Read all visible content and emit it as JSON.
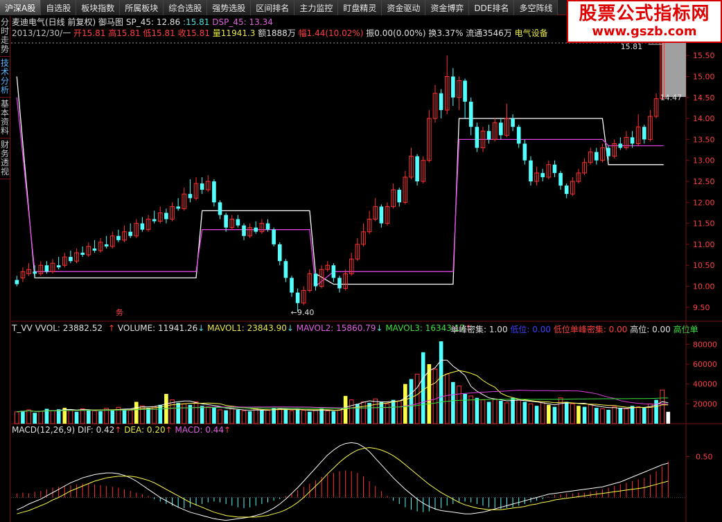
{
  "toolbar": {
    "items": [
      {
        "label": "沪深A股",
        "active": true
      },
      {
        "label": "自选股"
      },
      {
        "label": "板块指数"
      },
      {
        "label": "所属板块"
      },
      {
        "label": "综合选股"
      },
      {
        "label": "强势选股"
      },
      {
        "label": "区间排名"
      },
      {
        "label": "主力监控"
      },
      {
        "label": "盯盘精灵"
      },
      {
        "label": "资金驱动"
      },
      {
        "label": "资金博弈"
      },
      {
        "label": "DDE排名"
      },
      {
        "label": "多空阵线"
      }
    ]
  },
  "watermark": {
    "title": "股票公式指标网",
    "url": "www.gszb.com"
  },
  "left_tabs": [
    {
      "label": "分时走势"
    },
    {
      "label": "技术分析",
      "active": true
    },
    {
      "label": "基本资料"
    },
    {
      "label": "财务透视"
    }
  ],
  "header": {
    "stock_name": "麦迪电气(日线 前复权)",
    "indicator": "御马图",
    "sp_label": "SP_45: 12.86",
    "sp_value": "15.81",
    "dsp_label": "DSP_45: 13.34"
  },
  "quote": {
    "date": "2013/12/30/一",
    "open": "开15.81",
    "high": "高15.81",
    "low": "低15.81",
    "close": "收15.81",
    "volume": "量11941.3",
    "amount": "额1888万",
    "change": "幅1.44(10.02%)",
    "amplitude": "振0.00(0.00%)",
    "turnover": "换3.37%",
    "float_cap": "流通3546万",
    "sector": "电气设备"
  },
  "volume_legend": {
    "tvv": "T_VV VVOL: 23882.52",
    "volume": "VOLUME: 11941.26",
    "mavol1": "MAVOL1: 23843.90",
    "mavol2": "MAVOL2: 15860.79",
    "mavol3": "MAVOL3: 16343.17",
    "single_peak": "单峰密集: 1.00",
    "low_pos": "低位: 0.00",
    "low_peak": "低位单峰密集: 0.00",
    "high_pos": "高位: 0.00",
    "high_peak": "高位单"
  },
  "macd_legend": {
    "title": "MACD(12,26,9)",
    "dif": "DIF: 0.42",
    "dea": "DEA: 0.20",
    "macd": "MACD: 0.44"
  },
  "price_axis": {
    "labels": [
      "15.50",
      "15.00",
      "14.50",
      "14.00",
      "13.50",
      "13.00",
      "12.50",
      "12.00",
      "11.50",
      "11.00",
      "10.50",
      "10.00",
      "9.50"
    ]
  },
  "volume_axis": {
    "labels": [
      "80000",
      "60000",
      "40000",
      "20000"
    ]
  },
  "macd_axis": {
    "labels": [
      "0.50"
    ]
  },
  "annotations": {
    "high_marker": "15.81",
    "current_marker": "14.47",
    "low_marker": "9.40",
    "event_marker": "务"
  },
  "chart_data": {
    "type": "candlestick",
    "price_range": [
      9.2,
      15.8
    ],
    "candles": [
      [
        10.15,
        10.05,
        10.25,
        10.0
      ],
      [
        10.2,
        10.35,
        10.45,
        10.1
      ],
      [
        10.3,
        10.4,
        10.55,
        10.25
      ],
      [
        10.35,
        10.3,
        10.5,
        10.2
      ],
      [
        10.3,
        10.5,
        10.6,
        10.25
      ],
      [
        10.5,
        10.35,
        10.6,
        10.3
      ],
      [
        10.35,
        10.55,
        10.65,
        10.3
      ],
      [
        10.5,
        10.45,
        10.7,
        10.4
      ],
      [
        10.5,
        10.7,
        10.8,
        10.45
      ],
      [
        10.7,
        10.6,
        10.85,
        10.55
      ],
      [
        10.6,
        10.8,
        10.9,
        10.55
      ],
      [
        10.8,
        10.75,
        10.95,
        10.7
      ],
      [
        10.75,
        10.95,
        11.05,
        10.7
      ],
      [
        10.9,
        10.85,
        11.1,
        10.8
      ],
      [
        10.85,
        11.05,
        11.15,
        10.8
      ],
      [
        11.0,
        10.95,
        11.2,
        10.9
      ],
      [
        10.95,
        11.2,
        11.3,
        10.9
      ],
      [
        11.2,
        11.1,
        11.35,
        11.05
      ],
      [
        11.1,
        11.3,
        11.45,
        11.05
      ],
      [
        11.3,
        11.2,
        11.5,
        11.15
      ],
      [
        11.2,
        11.5,
        11.6,
        11.15
      ],
      [
        11.5,
        11.35,
        11.65,
        11.3
      ],
      [
        11.35,
        11.6,
        11.7,
        11.3
      ],
      [
        11.6,
        11.55,
        11.8,
        11.5
      ],
      [
        11.55,
        11.75,
        11.9,
        11.5
      ],
      [
        11.75,
        11.6,
        11.85,
        11.5
      ],
      [
        11.6,
        11.9,
        12.0,
        11.55
      ],
      [
        11.9,
        11.85,
        12.1,
        11.8
      ],
      [
        11.85,
        12.2,
        12.35,
        11.8
      ],
      [
        12.2,
        12.1,
        12.55,
        12.0
      ],
      [
        12.1,
        12.45,
        12.6,
        12.05
      ],
      [
        12.45,
        12.3,
        12.6,
        12.2
      ],
      [
        12.3,
        12.5,
        12.65,
        12.25
      ],
      [
        12.5,
        12.0,
        12.55,
        11.9
      ],
      [
        12.0,
        11.7,
        12.05,
        11.6
      ],
      [
        11.7,
        11.4,
        11.75,
        11.3
      ],
      [
        11.4,
        11.6,
        11.7,
        11.35
      ],
      [
        11.6,
        11.45,
        11.7,
        11.4
      ],
      [
        11.45,
        11.2,
        11.5,
        11.1
      ],
      [
        11.2,
        11.4,
        11.5,
        11.15
      ],
      [
        11.4,
        11.3,
        11.55,
        11.25
      ],
      [
        11.3,
        11.5,
        11.6,
        11.25
      ],
      [
        11.5,
        11.35,
        11.6,
        11.3
      ],
      [
        11.35,
        11.0,
        11.4,
        10.95
      ],
      [
        11.0,
        10.6,
        11.05,
        10.5
      ],
      [
        10.6,
        10.2,
        10.65,
        10.1
      ],
      [
        10.2,
        9.85,
        10.25,
        9.75
      ],
      [
        9.85,
        9.6,
        9.95,
        9.4
      ],
      [
        9.6,
        9.9,
        10.0,
        9.55
      ],
      [
        9.9,
        10.3,
        10.4,
        9.85
      ],
      [
        10.3,
        10.0,
        10.35,
        9.9
      ],
      [
        10.0,
        10.4,
        10.5,
        9.95
      ],
      [
        10.4,
        10.5,
        10.6,
        10.35
      ],
      [
        10.5,
        10.2,
        10.55,
        10.1
      ],
      [
        10.2,
        9.95,
        10.25,
        9.85
      ],
      [
        9.95,
        10.3,
        10.4,
        9.9
      ],
      [
        10.3,
        10.65,
        10.8,
        10.25
      ],
      [
        10.65,
        11.0,
        11.15,
        10.6
      ],
      [
        11.0,
        11.3,
        11.5,
        10.95
      ],
      [
        11.3,
        11.6,
        11.8,
        11.25
      ],
      [
        11.6,
        11.9,
        12.1,
        11.55
      ],
      [
        11.9,
        11.5,
        11.95,
        11.4
      ],
      [
        11.5,
        11.9,
        12.0,
        11.45
      ],
      [
        11.9,
        12.3,
        12.45,
        11.85
      ],
      [
        12.3,
        12.0,
        12.35,
        11.9
      ],
      [
        12.0,
        12.6,
        12.75,
        11.95
      ],
      [
        12.6,
        13.1,
        13.3,
        12.55
      ],
      [
        13.1,
        12.5,
        13.15,
        12.4
      ],
      [
        12.5,
        13.0,
        13.1,
        12.45
      ],
      [
        13.0,
        14.0,
        14.2,
        12.95
      ],
      [
        14.0,
        14.6,
        14.8,
        13.9
      ],
      [
        14.6,
        14.2,
        14.7,
        14.0
      ],
      [
        14.2,
        15.0,
        15.5,
        14.1
      ],
      [
        15.0,
        14.5,
        15.2,
        14.3
      ],
      [
        14.5,
        14.9,
        15.0,
        14.2
      ],
      [
        14.9,
        14.4,
        14.95,
        14.0
      ],
      [
        14.4,
        13.8,
        14.5,
        13.6
      ],
      [
        13.8,
        13.3,
        13.9,
        13.2
      ],
      [
        13.3,
        13.7,
        13.8,
        13.2
      ],
      [
        13.7,
        13.5,
        13.85,
        13.4
      ],
      [
        13.5,
        13.9,
        14.0,
        13.45
      ],
      [
        13.9,
        13.6,
        14.0,
        13.5
      ],
      [
        13.6,
        14.0,
        14.35,
        13.55
      ],
      [
        14.0,
        13.8,
        14.1,
        13.7
      ],
      [
        13.8,
        13.4,
        13.85,
        13.3
      ],
      [
        13.4,
        13.0,
        13.5,
        12.9
      ],
      [
        13.0,
        12.5,
        13.1,
        12.4
      ],
      [
        12.5,
        12.7,
        12.85,
        12.4
      ],
      [
        12.7,
        12.6,
        12.8,
        12.5
      ],
      [
        12.6,
        12.9,
        13.0,
        12.55
      ],
      [
        12.9,
        12.7,
        13.0,
        12.6
      ],
      [
        12.7,
        12.4,
        12.75,
        12.3
      ],
      [
        12.4,
        12.2,
        12.45,
        12.1
      ],
      [
        12.2,
        12.5,
        12.6,
        12.15
      ],
      [
        12.5,
        12.7,
        12.8,
        12.45
      ],
      [
        12.7,
        12.95,
        13.05,
        12.65
      ],
      [
        12.95,
        13.2,
        13.3,
        12.9
      ],
      [
        13.2,
        13.0,
        13.3,
        12.9
      ],
      [
        13.0,
        13.3,
        13.4,
        12.95
      ],
      [
        13.3,
        13.1,
        13.35,
        13.0
      ],
      [
        13.1,
        13.4,
        13.5,
        13.05
      ],
      [
        13.4,
        13.3,
        13.55,
        13.25
      ],
      [
        13.3,
        13.55,
        13.7,
        13.25
      ],
      [
        13.55,
        13.4,
        13.7,
        13.3
      ],
      [
        13.4,
        13.8,
        14.1,
        13.35
      ],
      [
        13.8,
        13.5,
        13.85,
        13.4
      ],
      [
        13.5,
        14.05,
        14.2,
        13.45
      ],
      [
        14.05,
        14.47,
        14.6,
        14.0
      ],
      [
        14.47,
        15.81,
        15.81,
        14.47
      ]
    ],
    "box_white": [
      [
        0,
        15
      ],
      [
        3,
        10.2
      ],
      [
        30,
        10.2
      ],
      [
        31,
        11.8
      ],
      [
        49,
        11.8
      ],
      [
        50,
        10.3
      ],
      [
        53,
        10.05
      ],
      [
        73,
        10.05
      ],
      [
        74,
        14.0
      ],
      [
        98,
        14.0
      ],
      [
        99,
        12.9
      ],
      [
        109,
        12.9
      ]
    ],
    "box_magenta": [
      [
        0,
        14.5
      ],
      [
        3,
        10.35
      ],
      [
        30,
        10.35
      ],
      [
        31,
        11.35
      ],
      [
        49,
        11.35
      ],
      [
        50,
        10.0
      ],
      [
        53,
        10.35
      ],
      [
        73,
        10.35
      ],
      [
        74,
        13.5
      ],
      [
        98,
        13.5
      ],
      [
        99,
        13.35
      ],
      [
        109,
        13.35
      ]
    ],
    "volume_range": [
      0,
      90000
    ],
    "volumes": [
      12000,
      13000,
      14000,
      11000,
      12500,
      15000,
      13000,
      14500,
      16000,
      13500,
      12000,
      15000,
      14000,
      13000,
      12500,
      15500,
      14000,
      16500,
      15000,
      13500,
      22000,
      18000,
      16000,
      17000,
      19000,
      30000,
      24000,
      21000,
      20000,
      19000,
      22000,
      18000,
      17000,
      16000,
      14000,
      13500,
      15000,
      14000,
      13000,
      12500,
      15000,
      14000,
      13500,
      16000,
      15500,
      14500,
      13000,
      14000,
      13500,
      12000,
      14000,
      15000,
      13000,
      12500,
      14000,
      28000,
      24000,
      20000,
      22000,
      21000,
      25000,
      22000,
      20000,
      24000,
      23000,
      40000,
      45000,
      50000,
      72000,
      60000,
      55000,
      83000,
      50000,
      42000,
      38000,
      30000,
      28000,
      26000,
      24000,
      22000,
      25000,
      23000,
      21000,
      26000,
      24000,
      22000,
      20000,
      18000,
      21000,
      19000,
      17000,
      26000,
      22000,
      20000,
      18000,
      17000,
      19000,
      16000,
      15000,
      14000,
      17000,
      16000,
      15000,
      18000,
      17000,
      16000,
      20000,
      24000,
      34000,
      12000
    ],
    "volume_colors": [
      "r",
      "c",
      "r",
      "c",
      "r",
      "c",
      "r",
      "c",
      "y",
      "r",
      "c",
      "r",
      "c",
      "r",
      "c",
      "r",
      "c",
      "r",
      "c",
      "r",
      "y",
      "r",
      "c",
      "r",
      "c",
      "y",
      "r",
      "c",
      "r",
      "c",
      "r",
      "c",
      "r",
      "c",
      "r",
      "c",
      "r",
      "c",
      "r",
      "c",
      "r",
      "c",
      "r",
      "c",
      "r",
      "c",
      "r",
      "c",
      "r",
      "c",
      "r",
      "c",
      "r",
      "c",
      "r",
      "y",
      "r",
      "c",
      "r",
      "c",
      "r",
      "c",
      "r",
      "c",
      "r",
      "y",
      "c",
      "r",
      "c",
      "y",
      "r",
      "c",
      "r",
      "c",
      "r",
      "c",
      "r",
      "c",
      "r",
      "c",
      "r",
      "c",
      "r",
      "c",
      "r",
      "c",
      "r",
      "c",
      "r",
      "y",
      "c",
      "r",
      "c",
      "r",
      "y",
      "c",
      "r",
      "c",
      "r",
      "c",
      "r",
      "c",
      "r",
      "c",
      "r",
      "c",
      "r",
      "c",
      "r",
      "w"
    ],
    "macd_range": [
      -0.3,
      0.75
    ],
    "macd_hist": [
      0.05,
      0.06,
      0.05,
      0.07,
      0.08,
      0.1,
      0.12,
      0.13,
      0.14,
      0.15,
      0.16,
      0.17,
      0.17,
      0.16,
      0.15,
      0.14,
      0.13,
      0.12,
      0.1,
      0.08,
      0.06,
      0.04,
      0.02,
      -0.02,
      -0.05,
      -0.08,
      -0.1,
      -0.12,
      -0.13,
      -0.12,
      -0.1,
      -0.08,
      -0.06,
      -0.05,
      -0.06,
      -0.08,
      -0.1,
      -0.12,
      -0.13,
      -0.12,
      -0.1,
      -0.08,
      -0.06,
      -0.04,
      -0.02,
      0.02,
      0.05,
      0.09,
      0.13,
      0.17,
      0.21,
      0.25,
      0.28,
      0.3,
      0.32,
      0.33,
      0.32,
      0.3,
      0.26,
      0.2,
      0.14,
      0.08,
      0.02,
      -0.04,
      -0.08,
      -0.12,
      -0.15,
      -0.17,
      -0.18,
      -0.17,
      -0.15,
      -0.13,
      -0.1,
      -0.08,
      -0.06,
      -0.05,
      -0.06,
      -0.08,
      -0.1,
      -0.12,
      -0.13,
      -0.14,
      -0.13,
      -0.12,
      -0.1,
      -0.08,
      -0.06,
      -0.04,
      -0.02,
      0.01,
      0.03,
      0.04,
      0.05,
      0.05,
      0.06,
      0.06,
      0.07,
      0.08,
      0.1,
      0.12,
      0.14,
      0.16,
      0.18,
      0.2,
      0.22,
      0.24,
      0.28,
      0.32,
      0.38,
      0.44
    ],
    "dif": [
      -0.15,
      -0.12,
      -0.08,
      -0.05,
      -0.02,
      0.02,
      0.06,
      0.1,
      0.14,
      0.18,
      0.21,
      0.24,
      0.26,
      0.28,
      0.29,
      0.3,
      0.3,
      0.29,
      0.27,
      0.24,
      0.2,
      0.15,
      0.1,
      0.05,
      0.0,
      -0.04,
      -0.08,
      -0.12,
      -0.15,
      -0.18,
      -0.2,
      -0.22,
      -0.24,
      -0.26,
      -0.27,
      -0.28,
      -0.27,
      -0.26,
      -0.25,
      -0.24,
      -0.22,
      -0.2,
      -0.17,
      -0.13,
      -0.08,
      -0.02,
      0.05,
      0.12,
      0.2,
      0.28,
      0.36,
      0.44,
      0.52,
      0.58,
      0.63,
      0.66,
      0.67,
      0.66,
      0.62,
      0.56,
      0.48,
      0.4,
      0.32,
      0.24,
      0.17,
      0.1,
      0.04,
      -0.02,
      -0.07,
      -0.11,
      -0.14,
      -0.16,
      -0.17,
      -0.18,
      -0.19,
      -0.2,
      -0.2,
      -0.19,
      -0.18,
      -0.16,
      -0.14,
      -0.12,
      -0.1,
      -0.08,
      -0.06,
      -0.04,
      -0.02,
      0.0,
      0.02,
      0.04,
      0.05,
      0.06,
      0.07,
      0.08,
      0.09,
      0.1,
      0.11,
      0.12,
      0.13,
      0.15,
      0.17,
      0.19,
      0.22,
      0.25,
      0.28,
      0.31,
      0.34,
      0.37,
      0.4,
      0.42
    ],
    "dea": [
      -0.2,
      -0.18,
      -0.16,
      -0.13,
      -0.1,
      -0.07,
      -0.03,
      0.0,
      0.04,
      0.08,
      0.11,
      0.14,
      0.17,
      0.2,
      0.22,
      0.24,
      0.25,
      0.26,
      0.26,
      0.26,
      0.25,
      0.23,
      0.21,
      0.18,
      0.14,
      0.1,
      0.06,
      0.02,
      -0.02,
      -0.06,
      -0.09,
      -0.12,
      -0.15,
      -0.18,
      -0.2,
      -0.22,
      -0.23,
      -0.24,
      -0.24,
      -0.24,
      -0.24,
      -0.23,
      -0.22,
      -0.2,
      -0.18,
      -0.15,
      -0.11,
      -0.06,
      0.0,
      0.07,
      0.14,
      0.21,
      0.29,
      0.36,
      0.43,
      0.49,
      0.54,
      0.58,
      0.6,
      0.61,
      0.6,
      0.58,
      0.55,
      0.51,
      0.46,
      0.4,
      0.34,
      0.28,
      0.22,
      0.16,
      0.11,
      0.06,
      0.02,
      -0.02,
      -0.06,
      -0.09,
      -0.11,
      -0.13,
      -0.14,
      -0.15,
      -0.15,
      -0.15,
      -0.14,
      -0.13,
      -0.12,
      -0.11,
      -0.09,
      -0.08,
      -0.06,
      -0.05,
      -0.03,
      -0.02,
      -0.01,
      0.0,
      0.01,
      0.02,
      0.03,
      0.04,
      0.05,
      0.06,
      0.07,
      0.08,
      0.09,
      0.1,
      0.11,
      0.12,
      0.14,
      0.16,
      0.18,
      0.2
    ]
  },
  "colors": {
    "up": "#ff3232",
    "down": "#54ffff",
    "yellow": "#ffff4a",
    "magenta": "#e040e0",
    "grid": "#7a1010",
    "axis_text": "#ff4040"
  }
}
